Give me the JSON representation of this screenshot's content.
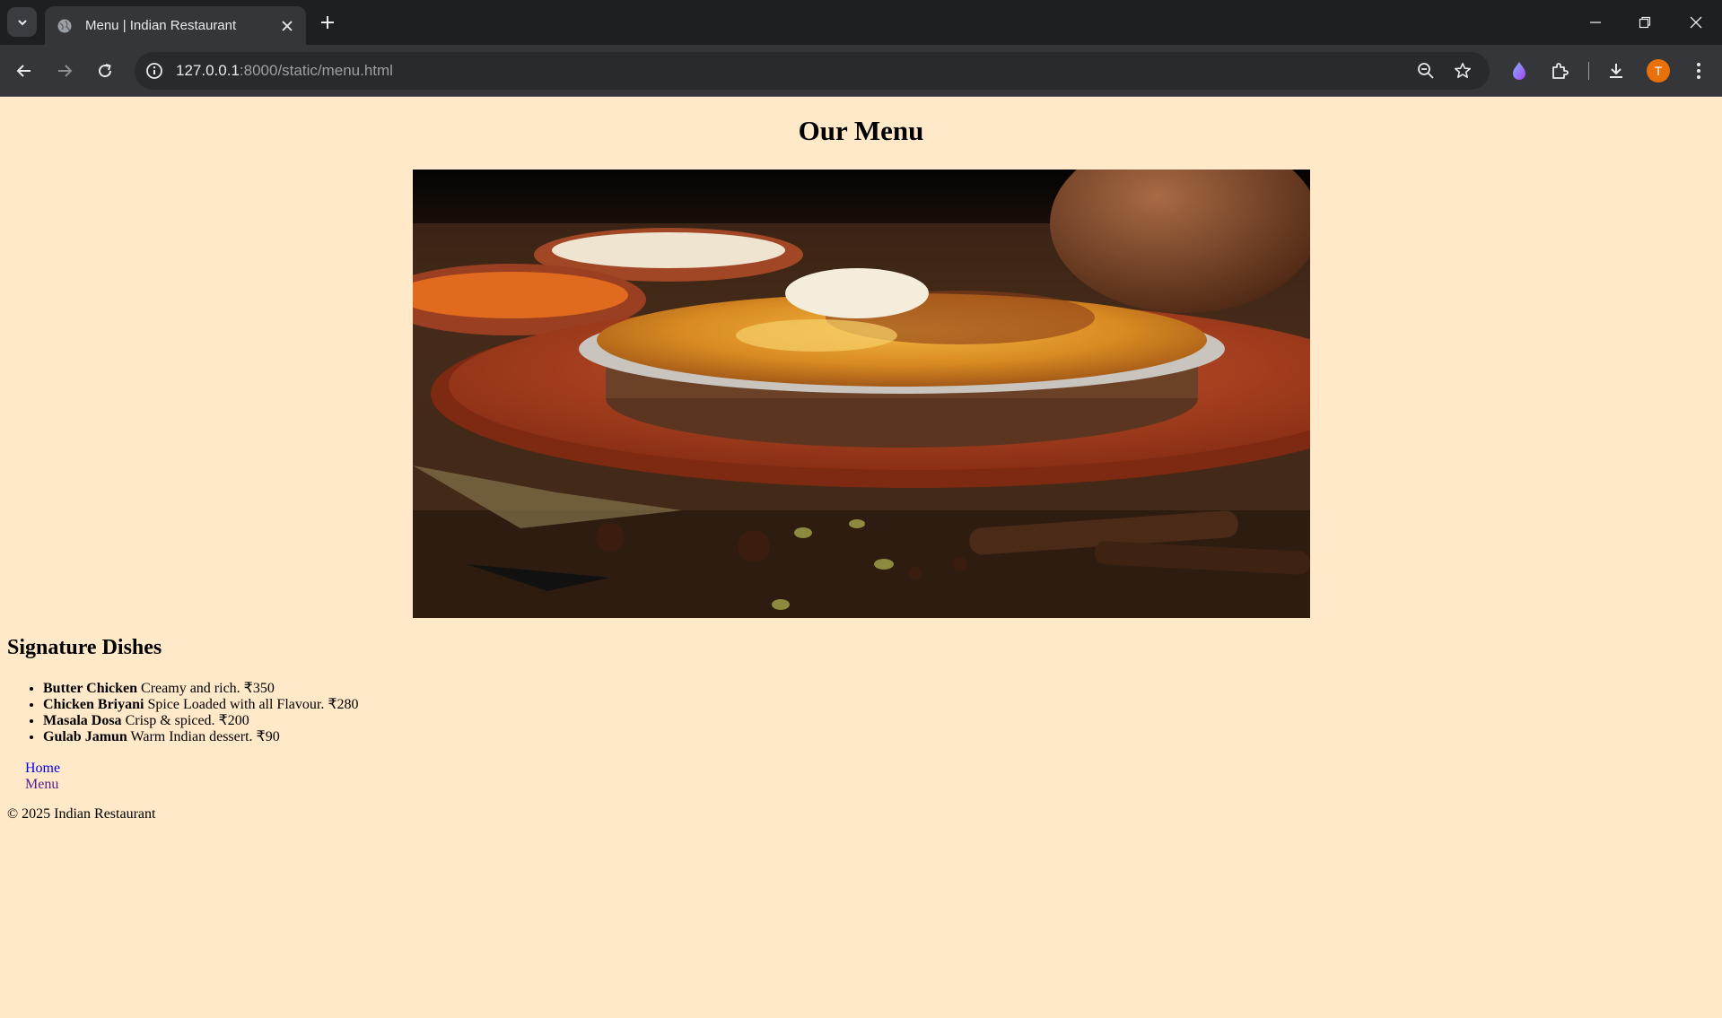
{
  "browser": {
    "tab_title": "Menu | Indian Restaurant",
    "url_host": "127.0.0.1",
    "url_rest": ":8000/static/menu.html",
    "avatar_initial": "T",
    "accent": "#e8710a"
  },
  "page": {
    "title": "Our Menu",
    "hero_image": "biryani-dish-image",
    "section_title": "Signature Dishes",
    "dishes": [
      {
        "name": "Butter Chicken",
        "desc": "Creamy and rich. ₹350"
      },
      {
        "name": "Chicken Briyani",
        "desc": "Spice Loaded with all Flavour. ₹280"
      },
      {
        "name": "Masala Dosa",
        "desc": "Crisp & spiced. ₹200"
      },
      {
        "name": "Gulab Jamun",
        "desc": "Warm Indian dessert. ₹90"
      }
    ],
    "nav": {
      "home": "Home",
      "menu": "Menu"
    },
    "footer": "© 2025 Indian Restaurant",
    "background": "#ffe9c9"
  }
}
